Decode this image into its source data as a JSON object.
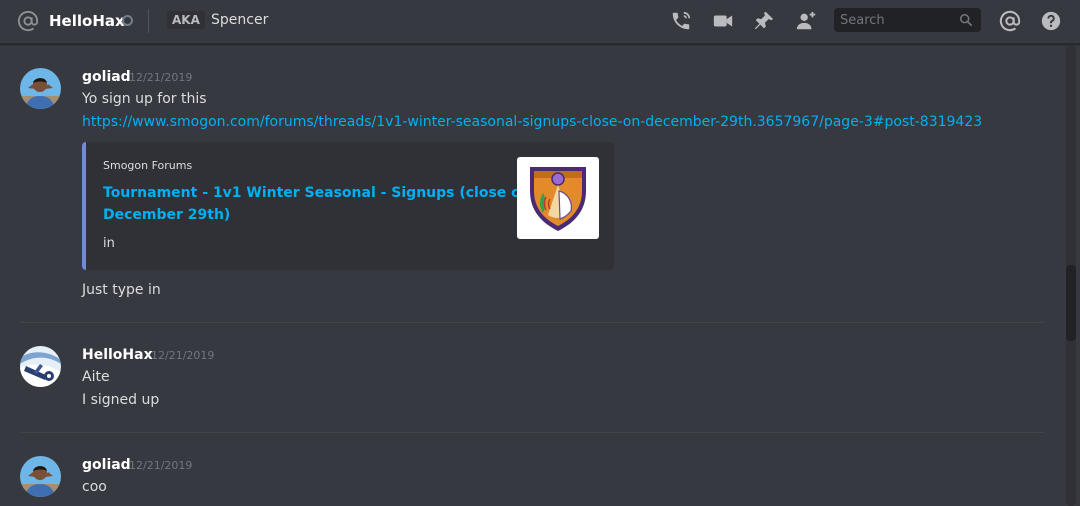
{
  "header": {
    "title": "HelloHax",
    "aka_badge": "AKA",
    "nickname": "Spencer",
    "search_placeholder": "Search",
    "icons": [
      "at-icon",
      "status-offline-icon",
      "phone-call-icon",
      "video-call-icon",
      "pin-icon",
      "add-friend-icon",
      "search-icon",
      "mention-icon",
      "help-icon"
    ]
  },
  "messages": [
    {
      "author": "goliad",
      "timestamp": "12/21/2019",
      "lines": [
        "Yo sign up for this",
        "https://www.smogon.com/forums/threads/1v1-winter-seasonal-signups-close-on-december-29th.3657967/page-3#post-8319423"
      ],
      "embed": {
        "provider": "Smogon Forums",
        "title_line1": "Tournament - 1v1 Winter Seasonal - Signups (close on",
        "title_line2": "December 29th)",
        "description": "in"
      },
      "after": "Just type in"
    },
    {
      "author": "HelloHax",
      "timestamp": "12/21/2019",
      "lines": [
        "Aite",
        "I signed up"
      ]
    },
    {
      "author": "goliad",
      "timestamp": "12/21/2019",
      "lines": [
        "coo"
      ]
    }
  ],
  "colors": {
    "background": "#36393f",
    "link": "#00b0f4",
    "embed_border": "#7289da",
    "embed_bg": "#2f3136"
  }
}
